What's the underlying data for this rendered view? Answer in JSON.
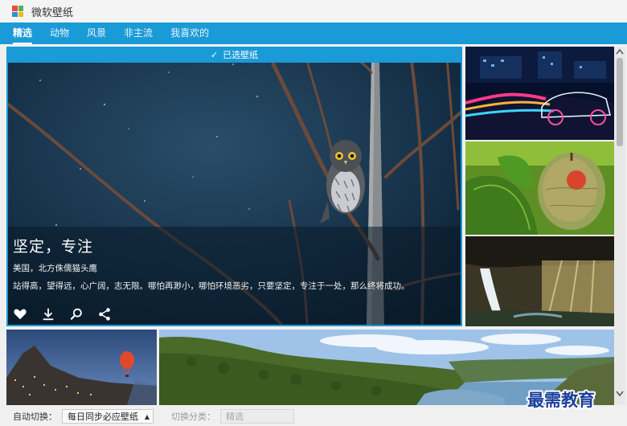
{
  "window": {
    "title": "微软壁纸"
  },
  "tabs": [
    {
      "label": "精选",
      "active": true
    },
    {
      "label": "动物"
    },
    {
      "label": "风景"
    },
    {
      "label": "非主流"
    },
    {
      "label": "我喜欢的"
    }
  ],
  "featured": {
    "selected_label": "已选壁纸",
    "title": "坚定，专注",
    "subtitle": "美国，北方侏儒猫头鹰",
    "description": "站得高，望得远，心广阔，志无限。哪怕再渺小，哪怕环境恶劣，只要坚定，专注于一处，那么终将成功。",
    "actions": [
      "heart-icon",
      "download-icon",
      "search-icon",
      "share-icon"
    ]
  },
  "thumbnails": [
    "neon-car",
    "green-leaf",
    "waterfall",
    "hill-town-balloon",
    "lake-landscape"
  ],
  "bottom": {
    "auto_switch_label": "自动切换：",
    "auto_switch_value": "每日同步必应壁纸",
    "category_label": "切换分类：",
    "category_value": "精选"
  },
  "watermark": "最需教育",
  "colors": {
    "accent": "#1a9ad6"
  }
}
